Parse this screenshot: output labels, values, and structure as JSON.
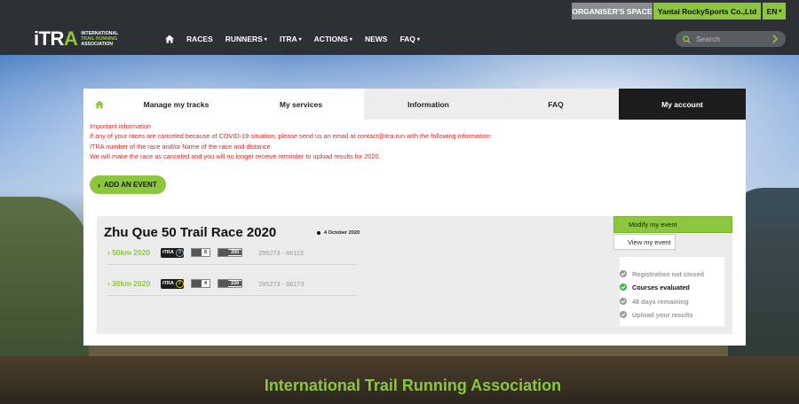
{
  "topbar": {
    "organiser_label": "ORGANISER'S SPACE",
    "club_label": "Yantai RockySports Co.,Ltd",
    "lang_label": "EN"
  },
  "logo": {
    "mark": "iTRA",
    "line1": "INTERNATIONAL",
    "line2": "TRAIL RUNNING",
    "line3": "ASSOCIATION"
  },
  "nav": {
    "items": [
      {
        "label": "RACES",
        "dropdown": false
      },
      {
        "label": "RUNNERS",
        "dropdown": true
      },
      {
        "label": "ITRA",
        "dropdown": true
      },
      {
        "label": "ACTIONS",
        "dropdown": true
      },
      {
        "label": "NEWS",
        "dropdown": false
      },
      {
        "label": "FAQ",
        "dropdown": true
      }
    ],
    "search_placeholder": "Search"
  },
  "tabs": [
    {
      "label": "Manage my tracks"
    },
    {
      "label": "My services"
    },
    {
      "label": "Information"
    },
    {
      "label": "FAQ"
    },
    {
      "label": "My account"
    }
  ],
  "notice": {
    "line1": "Important information",
    "line2": "If any of your races are canceled because of COVID-19 situation, please send us an email at contact@itra.run with the following information:",
    "line3": "ITRA number of the race and/or Name of the race and distance",
    "line4": "We will make the race as canceled and you will no longer receive reminder to upload results for 2020."
  },
  "add_event_label": "ADD AN EVENT",
  "event": {
    "title": "Zhu Que 50 Trail Race 2020",
    "date": "4 October 2020",
    "courses": [
      {
        "name": "50km 2020",
        "itra_label": "iTRA",
        "itra_points": "3",
        "mountain_level": "5",
        "km": "200",
        "id": "295273 - 66113"
      },
      {
        "name": "30km 2020",
        "itra_label": "iTRA",
        "itra_points": "2",
        "mountain_level": "4",
        "km": "220",
        "id": "295273 - 66173"
      }
    ],
    "modify_label": "Modify my event",
    "view_label": "View my event",
    "status": [
      {
        "label": "Registration not closed",
        "done": false
      },
      {
        "label": "Courses evaluated",
        "done": true
      },
      {
        "label": "48 days remaining",
        "done": false
      },
      {
        "label": "Upload your results",
        "done": false
      }
    ]
  },
  "footer": {
    "title": "International Trail Running Association"
  },
  "colors": {
    "brand_green": "#8cc63f",
    "nav_bg": "#2d3034",
    "notice_red": "#e02020",
    "ok_green": "#3ab54a"
  },
  "icons": [
    "home-icon",
    "search-icon",
    "arrow-right-icon",
    "chevron-right-icon",
    "mountain-icon",
    "distance-icon",
    "check-icon"
  ]
}
